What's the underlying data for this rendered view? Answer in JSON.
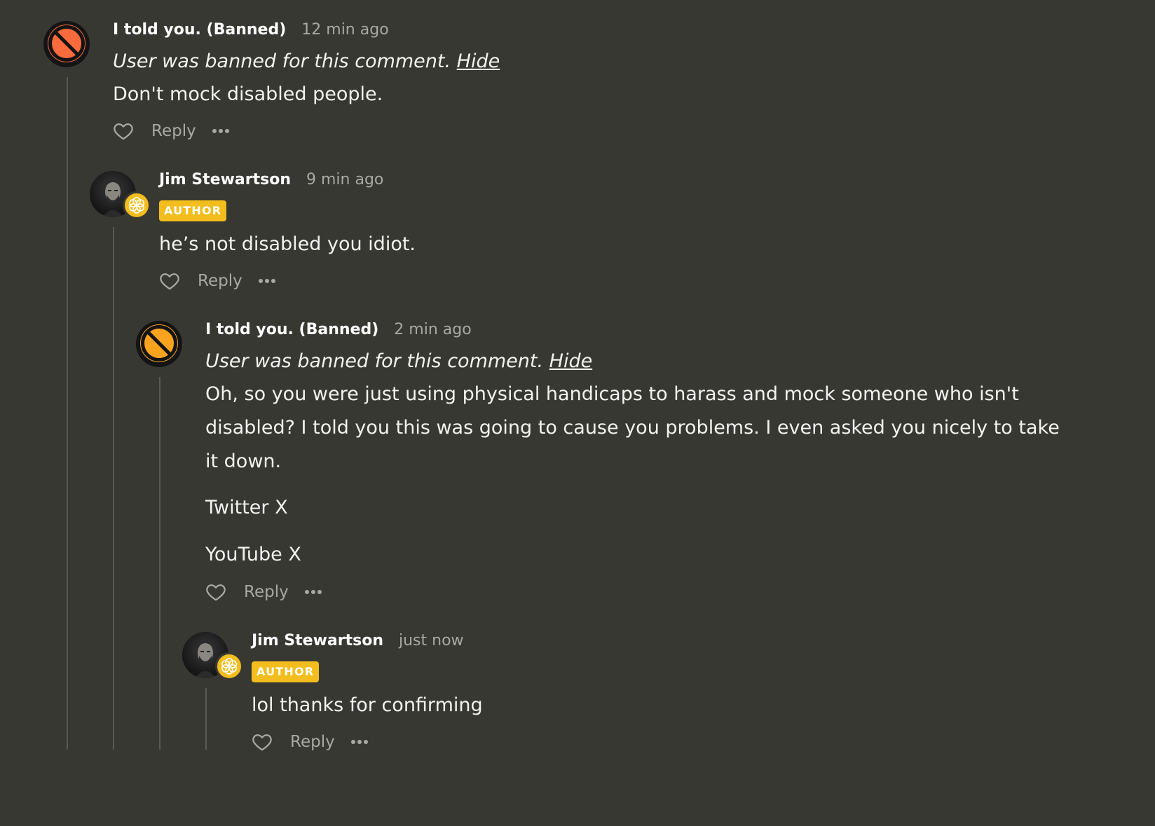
{
  "colors": {
    "background": "#383833",
    "author_badge": "#f2bd1d",
    "thread_line": "#5a5a54",
    "muted_text": "#a9a9a2",
    "banned_avatar_1": "#f96a3c",
    "banned_avatar_2": "#f9a31f"
  },
  "comments": [
    {
      "author": "I told you. (Banned)",
      "time": "12 min ago",
      "ban_note": "User was banned for this comment.",
      "hide_label": "Hide",
      "body": [
        "Don't mock disabled people."
      ],
      "reply_label": "Reply",
      "avatar_icon": "ban-icon"
    },
    {
      "author": "Jim Stewartson",
      "time": "9 min ago",
      "tag": "AUTHOR",
      "body": [
        "he’s not disabled you idiot."
      ],
      "reply_label": "Reply",
      "avatar_icon": "user-photo"
    },
    {
      "author": "I told you. (Banned)",
      "time": "2 min ago",
      "ban_note": "User was banned for this comment.",
      "hide_label": "Hide",
      "body": [
        "Oh, so you were just using physical handicaps to harass and mock someone who isn't disabled? I told you this was going to cause you problems. I even asked you nicely to take it down.",
        "Twitter X",
        "YouTube X"
      ],
      "reply_label": "Reply",
      "avatar_icon": "ban-icon"
    },
    {
      "author": "Jim Stewartson",
      "time": "just now",
      "tag": "AUTHOR",
      "body": [
        "lol thanks for confirming"
      ],
      "reply_label": "Reply",
      "avatar_icon": "user-photo"
    }
  ]
}
